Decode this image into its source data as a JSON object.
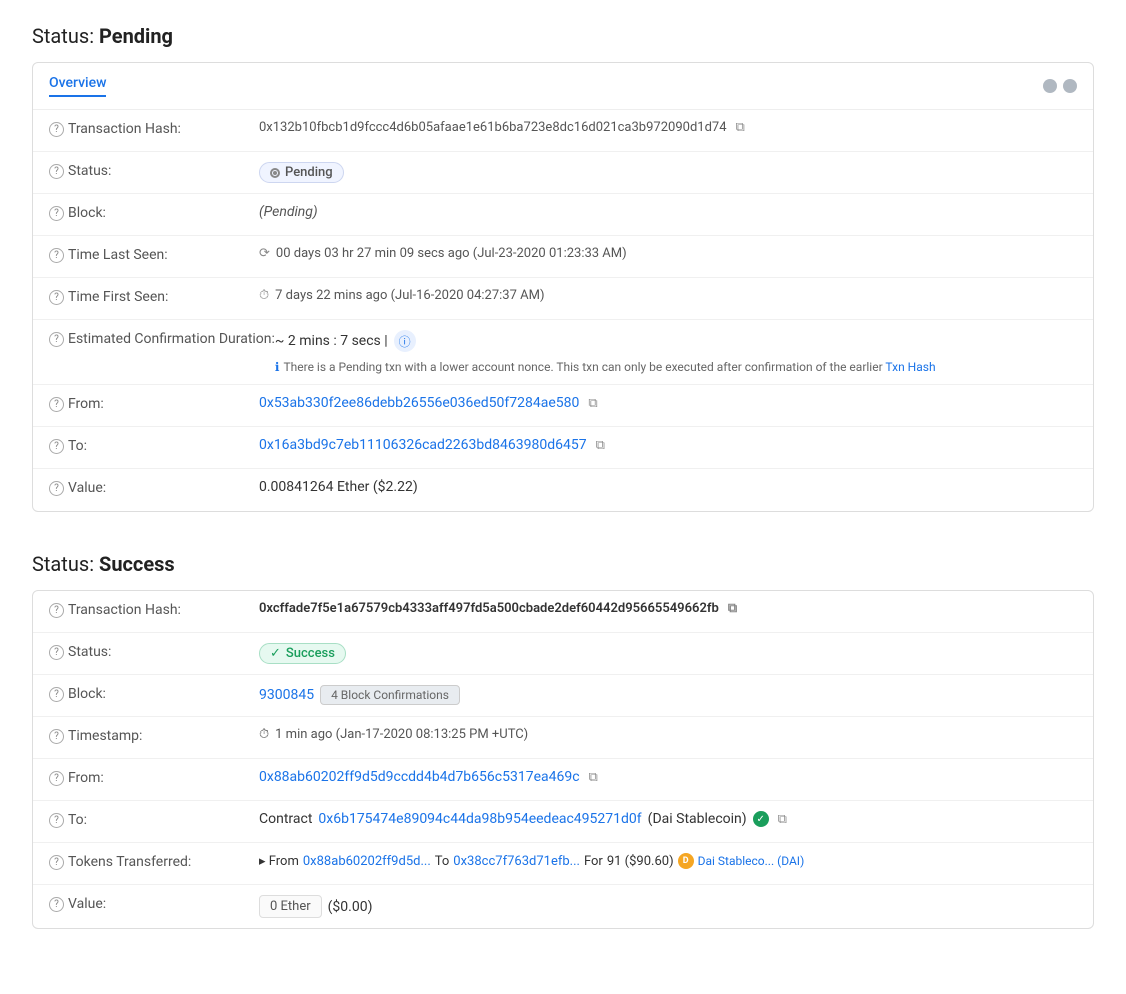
{
  "pending": {
    "section_title": "Status: ",
    "section_bold": "Pending",
    "tab_label": "Overview",
    "transaction_hash_label": "Transaction Hash:",
    "transaction_hash": "0x132b10fbcb1d9fccc4d6b05afaae1e61b6ba723e8dc16d021ca3b972090d1d74",
    "status_label": "Status:",
    "status_badge": "Pending",
    "block_label": "Block:",
    "block_value": "(Pending)",
    "time_last_seen_label": "Time Last Seen:",
    "time_last_seen": "00 days 03 hr 27 min 09 secs ago (Jul-23-2020 01:23:33 AM)",
    "time_first_seen_label": "Time First Seen:",
    "time_first_seen": "7 days 22 mins ago (Jul-16-2020 04:27:37 AM)",
    "est_confirmation_label": "Estimated Confirmation Duration:",
    "est_confirmation": "~ 2 mins : 7 secs |",
    "est_info": "There is a Pending txn with a lower account nonce. This txn can only be executed after confirmation of the earlier Txn Hash",
    "from_label": "From:",
    "from_address": "0x53ab330f2ee86debb26556e036ed50f7284ae580",
    "to_label": "To:",
    "to_address": "0x16a3bd9c7eb11106326cad2263bd8463980d6457",
    "value_label": "Value:",
    "value": "0.00841264 Ether ($2.22)"
  },
  "success": {
    "section_title": "Status: ",
    "section_bold": "Success",
    "transaction_hash_label": "Transaction Hash:",
    "transaction_hash": "0xcffade7f5e1a67579cb4333aff497fd5a500cbade2def60442d95665549662fb",
    "status_label": "Status:",
    "status_badge": "Success",
    "block_label": "Block:",
    "block_number": "9300845",
    "block_confirmations": "4 Block Confirmations",
    "timestamp_label": "Timestamp:",
    "timestamp": "1 min ago (Jan-17-2020 08:13:25 PM +UTC)",
    "from_label": "From:",
    "from_address": "0x88ab60202ff9d5d9ccdd4b4d7b656c5317ea469c",
    "to_label": "To:",
    "to_prefix": "Contract",
    "to_address": "0x6b175474e89094c44da98b954eedeac495271d0f",
    "to_name": "(Dai Stablecoin)",
    "tokens_label": "Tokens Transferred:",
    "tokens_from_prefix": "▸ From",
    "tokens_from": "0x88ab60202ff9d5d...",
    "tokens_to_prefix": "To",
    "tokens_to": "0x38cc7f763d71efb...",
    "tokens_for": "For",
    "tokens_amount": "91 ($90.60)",
    "tokens_dai": "Dai Stableco... (DAI)",
    "value_label": "Value:",
    "value_eth": "0 Ether",
    "value_usd": "($0.00)"
  },
  "icons": {
    "question": "?",
    "copy": "⧉",
    "clock": "⏱",
    "spinner": "⟳",
    "check": "✓",
    "info": "ℹ",
    "arrow": "▸"
  }
}
